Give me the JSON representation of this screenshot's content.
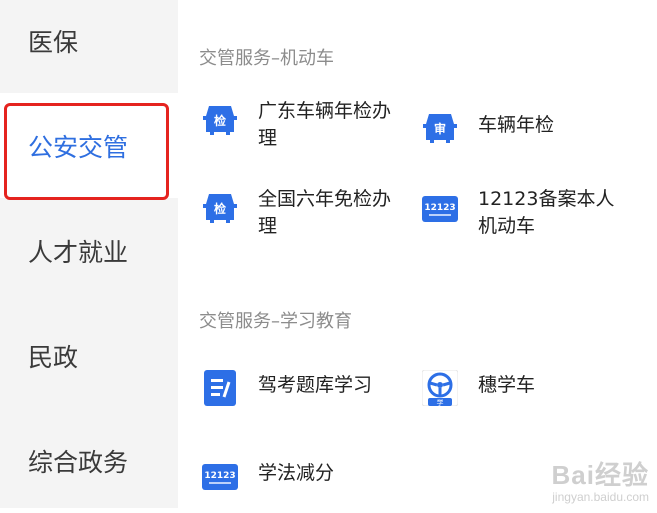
{
  "sidebar": {
    "items": [
      {
        "label": "医保"
      },
      {
        "label": "公安交管"
      },
      {
        "label": "人才就业"
      },
      {
        "label": "民政"
      },
      {
        "label": "综合政务"
      }
    ],
    "active_index": 1
  },
  "sections": [
    {
      "title": "交管服务–机动车",
      "services": [
        {
          "label_line1": "广东车辆年检办",
          "label_line2": "理",
          "icon": "car-inspect-icon",
          "icon_text": "检"
        },
        {
          "label_line1": "车辆年检",
          "label_line2": "",
          "icon": "car-review-icon",
          "icon_text": "审"
        },
        {
          "label_line1": "全国六年免检办",
          "label_line2": "理",
          "icon": "car-inspect-icon",
          "icon_text": "检"
        },
        {
          "label_line1": "12123备案本人",
          "label_line2": "机动车",
          "icon": "app-12123-icon",
          "icon_text": "12123"
        }
      ]
    },
    {
      "title": "交管服务–学习教育",
      "services": [
        {
          "label_line1": "驾考题库学习",
          "label_line2": "",
          "icon": "quiz-icon",
          "icon_text": ""
        },
        {
          "label_line1": "穗学车",
          "label_line2": "",
          "icon": "steering-wheel-icon",
          "icon_text": "学"
        },
        {
          "label_line1": "学法减分",
          "label_line2": "",
          "icon": "app-12123-icon",
          "icon_text": "12123"
        }
      ]
    }
  ],
  "colors": {
    "accent": "#2f6fe0",
    "icon_blue": "#2d6fe6",
    "highlight": "#e5231f",
    "sidebar_bg": "#f4f4f4"
  },
  "watermark": {
    "brand": "Bai经验",
    "domain": "jingyan.baidu.com"
  }
}
